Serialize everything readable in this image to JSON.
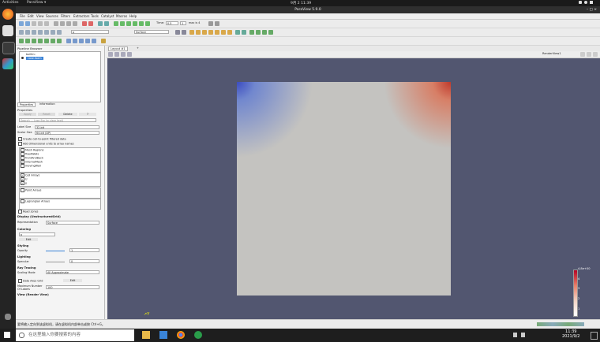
{
  "topbar": {
    "activities": "Activities",
    "app": "ParaView ▾",
    "clock": "9月 2 11:39"
  },
  "window": {
    "title": "ParaView 5.9.0"
  },
  "menu": [
    "File",
    "Edit",
    "View",
    "Sources",
    "Filters",
    "Extractors",
    "Tools",
    "Catalyst",
    "Macros",
    "Help"
  ],
  "toolbar": {
    "time_label": "Time:",
    "time_value": "0.5",
    "step_value": "1",
    "max_label": "max is 4",
    "field_value": "p",
    "representation": "Surface"
  },
  "pipeline": {
    "title": "Pipeline Browser",
    "builtin": "builtin:",
    "source": "case.foam"
  },
  "properties": {
    "tabs": [
      "Properties",
      "Information"
    ],
    "header": "Properties",
    "apply": "Apply",
    "reset": "Reset",
    "delete": "Delete",
    "help": "?",
    "search_placeholder": "Search ... (use Esc to clear text)",
    "label_size_label": "Label Size",
    "label_size_value": "32-bit",
    "scalar_size_label": "Scalar Size",
    "scalar_size_value": "64-bit (DP)",
    "create_c2p": "Create cell-to-point filtered data",
    "add_dim": "Add dimensional units to array names",
    "mesh_regions_header": "Mesh Regions",
    "mesh_regions": [
      "fixedWalls",
      "frontAndBack",
      "internalMesh",
      "movingWall"
    ],
    "cell_arrays_header": "Cell Arrays",
    "cell_arrays": [
      "U",
      "p"
    ],
    "point_arrays_header": "Point Arrays",
    "lagrangian_header": "Lagrangian Arrays",
    "read_zones": "Read zones",
    "display_header": "Display (UnstructuredGrid)",
    "representation_label": "Representation",
    "representation_value": "Surface",
    "coloring_header": "Coloring",
    "coloring_value": "p",
    "edit_label": "Edit",
    "styling_header": "Styling",
    "opacity_label": "Opacity",
    "opacity_value": "1",
    "lighting_header": "Lighting",
    "specular_label": "Specular",
    "specular_value": "0",
    "ray_header": "Ray Tracing",
    "scaling_label": "Scaling Mode",
    "scaling_value": "All Approximate",
    "data_axes_label": "Data Axes Grid",
    "data_axes_value": "Edit",
    "max_labels_label": "Maximum Number Of Labels",
    "max_labels_value": "100",
    "view_header": "View (Render View)"
  },
  "view": {
    "tab_label": "Layout #1",
    "render_label": "RenderView1"
  },
  "colorbar": {
    "max_label": "4.8e+00",
    "ticks": [
      "4",
      "3",
      "2",
      "1"
    ]
  },
  "status": {
    "message": "要将输入定向到该虚拟机，请在虚拟机内部单击或按 Ctrl+G。"
  },
  "taskbar": {
    "search_placeholder": "在这里输入你要搜索的内容",
    "time": "11:39",
    "date": "2021/9/2"
  },
  "colors": {
    "render_bg": "#525670",
    "cold": "#3b4cc0",
    "hot": "#c0392b"
  }
}
